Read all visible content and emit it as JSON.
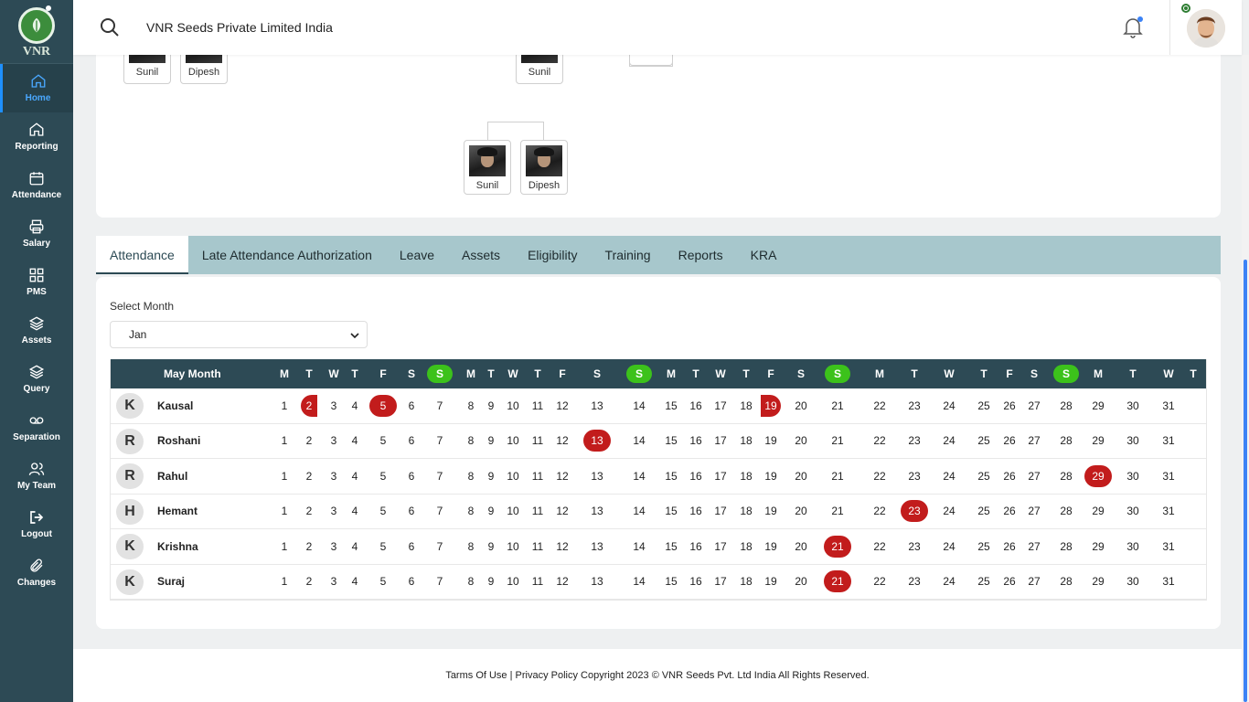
{
  "logo_text": "VNR",
  "nav": [
    {
      "label": "Home",
      "icon": "home-icon"
    },
    {
      "label": "Reporting",
      "icon": "home-icon"
    },
    {
      "label": "Attendance",
      "icon": "calendar-icon"
    },
    {
      "label": "Salary",
      "icon": "printer-icon"
    },
    {
      "label": "PMS",
      "icon": "grid-icon"
    },
    {
      "label": "Assets",
      "icon": "layers-icon"
    },
    {
      "label": "Query",
      "icon": "layers-icon"
    },
    {
      "label": "Separation",
      "icon": "voicemail-icon"
    },
    {
      "label": "My Team",
      "icon": "team-icon"
    },
    {
      "label": "Logout",
      "icon": "logout-icon"
    },
    {
      "label": "Changes",
      "icon": "paperclip-icon"
    }
  ],
  "header": {
    "company": "VNR Seeds Private Limited India"
  },
  "org_nodes": [
    {
      "name": "Sunil"
    },
    {
      "name": "Dipesh"
    },
    {
      "name": "Sunil"
    },
    {
      "name": "Sunil"
    },
    {
      "name": "Dipesh"
    }
  ],
  "tabs": [
    "Attendance",
    "Late Attendance Authorization",
    "Leave",
    "Assets",
    "Eligibility",
    "Training",
    "Reports",
    "KRA"
  ],
  "active_tab": "Attendance",
  "attendance": {
    "select_label": "Select Month",
    "selected_month": "Jan",
    "month_header": "May Month",
    "weekday_headers": [
      "M",
      "T",
      "W",
      "T",
      "F",
      "S",
      "S",
      "M",
      "T",
      "W",
      "T",
      "F",
      "S",
      "S",
      "M",
      "T",
      "W",
      "T",
      "F",
      "S",
      "S",
      "M",
      "T",
      "W",
      "T",
      "F",
      "S",
      "S",
      "M",
      "T",
      "W",
      "T"
    ],
    "sunday_days": [
      7,
      14,
      21,
      28
    ],
    "days": [
      1,
      2,
      3,
      4,
      5,
      6,
      7,
      8,
      9,
      10,
      11,
      12,
      13,
      14,
      15,
      16,
      17,
      18,
      19,
      20,
      21,
      22,
      23,
      24,
      25,
      26,
      27,
      28,
      29,
      30,
      31
    ],
    "employees": [
      {
        "initial": "K",
        "name": "Kausal",
        "highlights": {
          "2": "left-half",
          "5": "full",
          "19": "right-half"
        }
      },
      {
        "initial": "R",
        "name": "Roshani",
        "highlights": {
          "13": "full"
        }
      },
      {
        "initial": "R",
        "name": "Rahul",
        "highlights": {
          "29": "full"
        }
      },
      {
        "initial": "H",
        "name": "Hemant",
        "highlights": {
          "23": "full"
        }
      },
      {
        "initial": "K",
        "name": "Krishna",
        "highlights": {
          "21": "full"
        }
      },
      {
        "initial": "K",
        "name": "Suraj",
        "highlights": {
          "21": "full"
        }
      }
    ],
    "colors": {
      "weekend": "#3cc21b",
      "absent": "#c21c1c",
      "header_bg": "#2d4a55"
    }
  },
  "footer": {
    "text": "Tarms Of Use | Privacy Policy Copyright 2023 © VNR Seeds Pvt. Ltd India All Rights Reserved."
  }
}
